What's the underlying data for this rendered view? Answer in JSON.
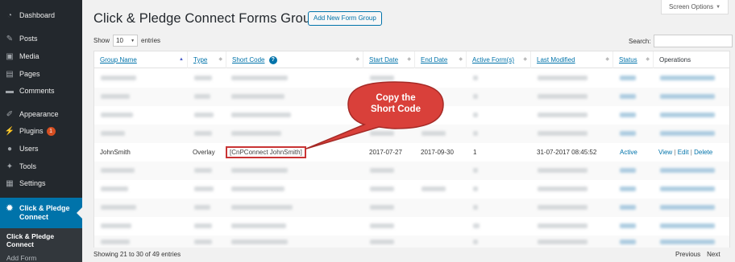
{
  "sidebar": {
    "items": [
      {
        "label": "Dashboard",
        "icon": "dashboard-icon",
        "glyph": "◔"
      },
      {
        "label": "Posts",
        "icon": "pin-icon",
        "glyph": "✎"
      },
      {
        "label": "Media",
        "icon": "media-icon",
        "glyph": "▣"
      },
      {
        "label": "Pages",
        "icon": "pages-icon",
        "glyph": "▤"
      },
      {
        "label": "Comments",
        "icon": "comments-icon",
        "glyph": "▬"
      },
      {
        "label": "Appearance",
        "icon": "brush-icon",
        "glyph": "✐"
      },
      {
        "label": "Plugins",
        "icon": "plugin-icon",
        "glyph": "⚡",
        "badge": "1"
      },
      {
        "label": "Users",
        "icon": "users-icon",
        "glyph": "●"
      },
      {
        "label": "Tools",
        "icon": "wrench-icon",
        "glyph": "✦"
      },
      {
        "label": "Settings",
        "icon": "settings-icon",
        "glyph": "▦"
      }
    ],
    "active": {
      "label": "Click & Pledge Connect",
      "icon": "gear-icon",
      "glyph": "✹"
    },
    "submenu": {
      "current": "Click & Pledge Connect",
      "next": "Add Form"
    }
  },
  "header": {
    "title": "Click & Pledge Connect Forms Groups",
    "add_button": "Add New Form Group",
    "screen_options": "Screen Options",
    "screen_options_chevron": "▼"
  },
  "controls": {
    "show_label": "Show",
    "entries_value": "10",
    "entries_label": "entries",
    "search_label": "Search:",
    "help_glyph": "?"
  },
  "table": {
    "columns": [
      "Group Name",
      "Type",
      "Short Code",
      "Start Date",
      "End Date",
      "Active Form(s)",
      "Last Modified",
      "Status",
      "Operations"
    ],
    "visible_row": {
      "group_name": "JohnSmith",
      "type": "Overlay",
      "short_code": "[CnPConnect JohnSmith]",
      "start_date": "2017-07-27",
      "end_date": "2017-09-30",
      "active_forms": "1",
      "last_modified": "31-07-2017 08:45:52",
      "status": "Active",
      "op_view": "View",
      "op_edit": "Edit",
      "op_delete": "Delete",
      "separator": "|"
    }
  },
  "callout": {
    "line1": "Copy the",
    "line2": "Short Code",
    "fill": "#d9403a",
    "border": "#a52a26"
  },
  "footer": {
    "info": "Showing 21 to 30 of 49 entries",
    "previous": "Previous",
    "next": "Next"
  },
  "colors": {
    "sidebar": "#23282d",
    "accent": "#0073aa",
    "highlight": "#c93434"
  }
}
